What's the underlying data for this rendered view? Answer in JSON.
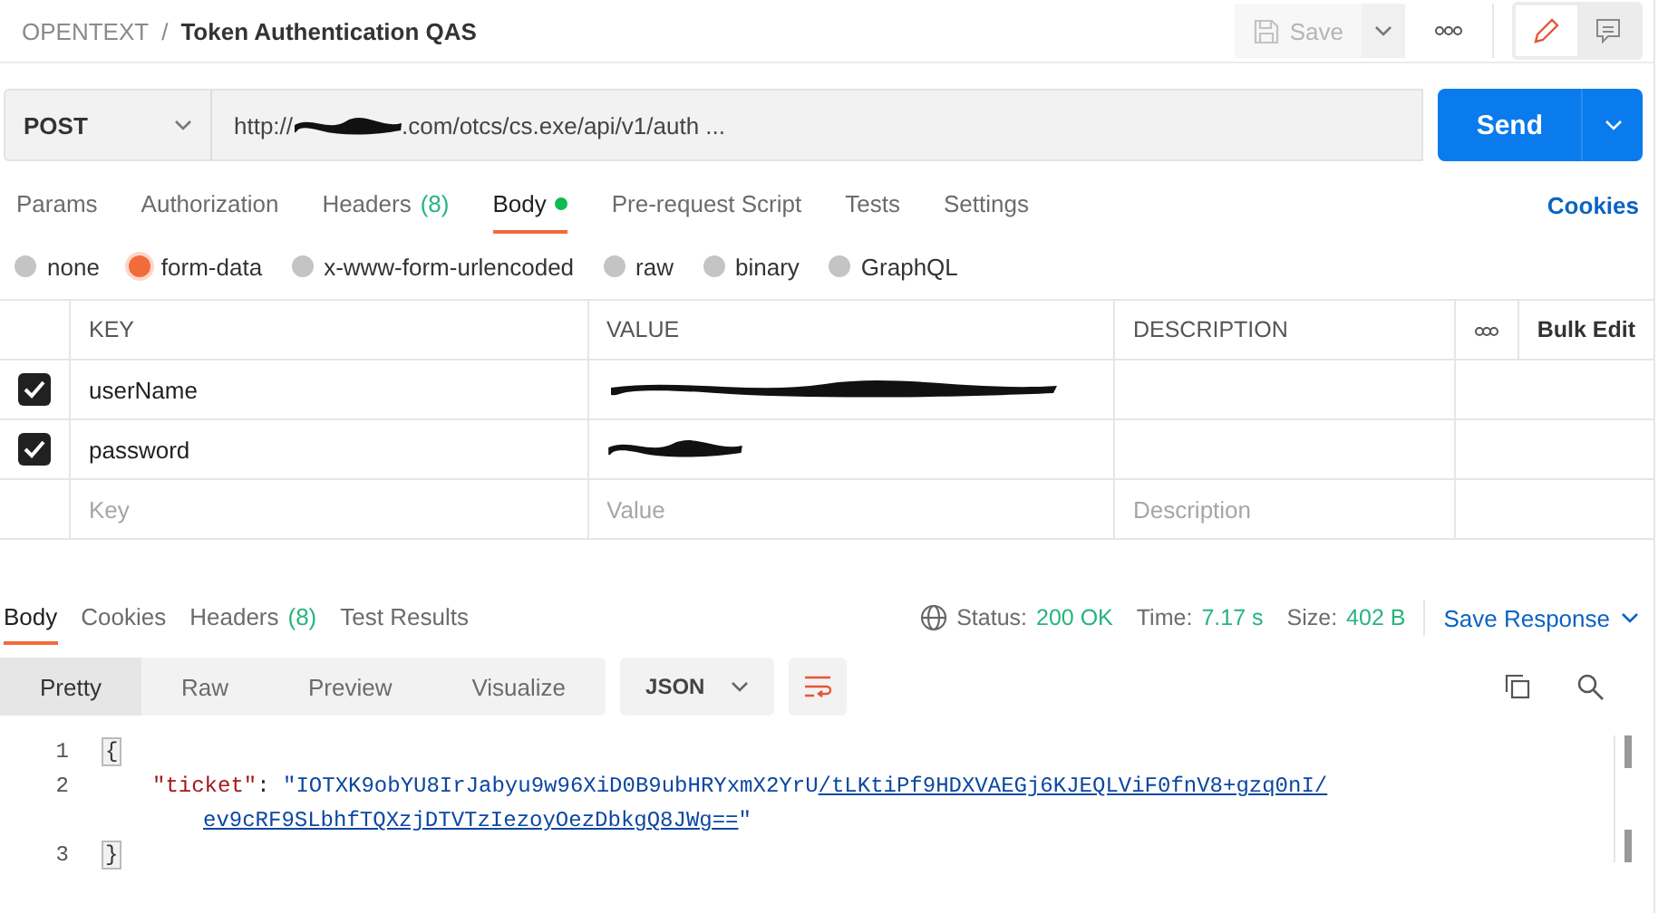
{
  "breadcrumb": {
    "workspace": "OPENTEXT",
    "separator": "/",
    "title": "Token Authentication QAS"
  },
  "header_actions": {
    "save": {
      "label": "Save",
      "disabled": true
    }
  },
  "request": {
    "method": "POST",
    "url_start": "http://",
    "url_redacted": true,
    "url_end": ".com/otcs/cs.exe/api/v1/auth ...",
    "send": "Send"
  },
  "request_tabs": [
    {
      "label": "Params",
      "selected": false
    },
    {
      "label": "Authorization",
      "selected": false
    },
    {
      "label": "Headers",
      "count": "(8)",
      "selected": false
    },
    {
      "label": "Body",
      "selected": true,
      "has_content": true
    },
    {
      "label": "Pre-request Script",
      "selected": false
    },
    {
      "label": "Tests",
      "selected": false
    },
    {
      "label": "Settings",
      "selected": false
    }
  ],
  "cookies_link": "Cookies",
  "body_types": [
    {
      "label": "none",
      "selected": false
    },
    {
      "label": "form-data",
      "selected": true
    },
    {
      "label": "x-www-form-urlencoded",
      "selected": false
    },
    {
      "label": "raw",
      "selected": false
    },
    {
      "label": "binary",
      "selected": false
    },
    {
      "label": "GraphQL",
      "selected": false
    }
  ],
  "params_table": {
    "columns": [
      "KEY",
      "VALUE",
      "DESCRIPTION"
    ],
    "bulk_edit": "Bulk Edit",
    "rows": [
      {
        "checked": true,
        "key": "userName",
        "value_redacted": true
      },
      {
        "checked": true,
        "key": "password",
        "value_redacted": true
      }
    ],
    "new_row": {
      "key_field": {
        "placeholder": "Key"
      },
      "value_field": {
        "placeholder": "Value"
      },
      "description_field": {
        "placeholder": "Description"
      }
    }
  },
  "response": {
    "tabs": [
      {
        "label": "Body",
        "selected": true
      },
      {
        "label": "Cookies",
        "selected": false
      },
      {
        "label": "Headers",
        "count": "(8)",
        "selected": false
      },
      {
        "label": "Test Results",
        "selected": false
      }
    ],
    "status_label": "Status:",
    "status": "200 OK",
    "time_label": "Time:",
    "time": "7.17 s",
    "size_label": "Size:",
    "size": "402 B",
    "save_response": "Save Response",
    "views": [
      {
        "label": "Pretty",
        "selected": true
      },
      {
        "label": "Raw",
        "selected": false
      },
      {
        "label": "Preview",
        "selected": false
      },
      {
        "label": "Visualize",
        "selected": false
      }
    ],
    "format": "JSON",
    "lines": [
      {
        "number": "1",
        "kind": "bracket",
        "text": "{"
      },
      {
        "number": "2",
        "kind": "pair",
        "key": "\"ticket\"",
        "colon": ":",
        "string_start": "\"IOTXK9obYU8IrJabyu9w96XiD0B9ubHRYxmX2YrU",
        "link_lines": [
          "/tLKtiPf9HDXVAEGj6KJEQLViF0fnV8+gzq0nI/",
          "ev9cRF9SLbhfTQXzjDTVTzIezoyOezDbkgQ8JWg=="
        ],
        "string_end": "\""
      },
      {
        "number": "3",
        "kind": "bracket",
        "text": "}"
      }
    ]
  }
}
